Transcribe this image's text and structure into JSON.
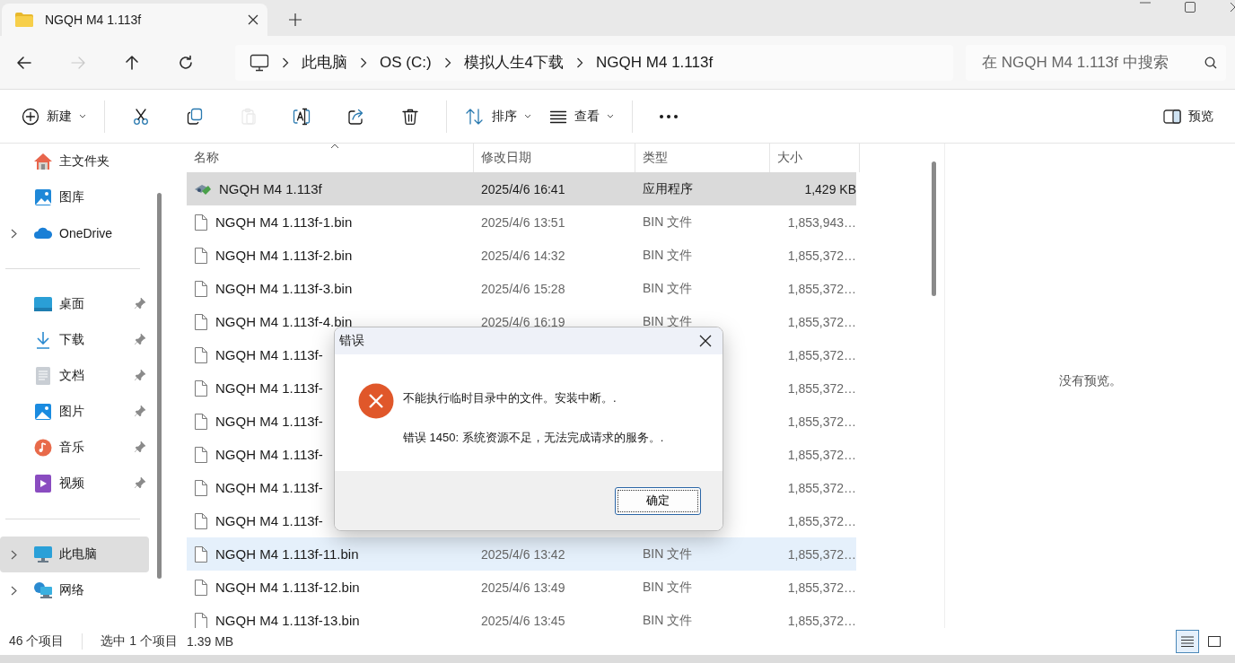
{
  "window": {
    "tab_title": "NGQH M4 1.113f"
  },
  "nav": [
    {
      "kind": "back",
      "disabled": false
    },
    {
      "kind": "forward",
      "disabled": true
    },
    {
      "kind": "up",
      "disabled": false
    },
    {
      "kind": "refresh",
      "disabled": false
    }
  ],
  "breadcrumb": [
    "此电脑",
    "OS (C:)",
    "模拟人生4下载",
    "NGQH M4 1.113f"
  ],
  "search": {
    "placeholder": "在 NGQH M4 1.113f 中搜索"
  },
  "toolbar": [
    {
      "kind": "new",
      "label": "新建",
      "disabled": false
    },
    {
      "kind": "cut",
      "disabled": false
    },
    {
      "kind": "copy",
      "disabled": false
    },
    {
      "kind": "paste",
      "disabled": true
    },
    {
      "kind": "rename",
      "disabled": false
    },
    {
      "kind": "share",
      "disabled": false
    },
    {
      "kind": "delete",
      "disabled": false
    },
    {
      "kind": "sort",
      "label": "排序",
      "disabled": false
    },
    {
      "kind": "view",
      "label": "查看",
      "disabled": false
    },
    {
      "kind": "more",
      "disabled": false
    }
  ],
  "preview_button": {
    "label": "预览"
  },
  "sidebar": {
    "groups": [
      [
        {
          "label": "主文件夹",
          "kind": "home",
          "expandable": false,
          "pinned": false,
          "selected": false
        },
        {
          "label": "图库",
          "kind": "gallery",
          "expandable": false,
          "pinned": false,
          "selected": false
        },
        {
          "label": "OneDrive",
          "kind": "cloud",
          "expandable": true,
          "pinned": false,
          "selected": false
        }
      ],
      [
        {
          "label": "桌面",
          "kind": "desktop",
          "expandable": false,
          "pinned": true,
          "selected": false
        },
        {
          "label": "下载",
          "kind": "download",
          "expandable": false,
          "pinned": true,
          "selected": false
        },
        {
          "label": "文档",
          "kind": "document",
          "expandable": false,
          "pinned": true,
          "selected": false
        },
        {
          "label": "图片",
          "kind": "pictures",
          "expandable": false,
          "pinned": true,
          "selected": false
        },
        {
          "label": "音乐",
          "kind": "music",
          "expandable": false,
          "pinned": true,
          "selected": false
        },
        {
          "label": "视频",
          "kind": "video",
          "expandable": false,
          "pinned": true,
          "selected": false
        }
      ],
      [
        {
          "label": "此电脑",
          "kind": "pc",
          "expandable": true,
          "pinned": false,
          "selected": true
        },
        {
          "label": "网络",
          "kind": "network",
          "expandable": true,
          "pinned": false,
          "selected": false
        }
      ]
    ]
  },
  "columns": [
    {
      "label": "名称",
      "sorted": true
    },
    {
      "label": "修改日期",
      "sorted": false
    },
    {
      "label": "类型",
      "sorted": false
    },
    {
      "label": "大小",
      "sorted": false
    }
  ],
  "rows": [
    {
      "kind": "app",
      "name": "NGQH M4 1.113f",
      "date": "2025/4/6 16:41",
      "type": "应用程序",
      "size": "1,429 KB",
      "selected": true,
      "hovered": false
    },
    {
      "kind": "file",
      "name": "NGQH M4 1.113f-1.bin",
      "date": "2025/4/6 13:51",
      "type": "BIN 文件",
      "size": "1,853,943…",
      "selected": false,
      "hovered": false
    },
    {
      "kind": "file",
      "name": "NGQH M4 1.113f-2.bin",
      "date": "2025/4/6 14:32",
      "type": "BIN 文件",
      "size": "1,855,372…",
      "selected": false,
      "hovered": false
    },
    {
      "kind": "file",
      "name": "NGQH M4 1.113f-3.bin",
      "date": "2025/4/6 15:28",
      "type": "BIN 文件",
      "size": "1,855,372…",
      "selected": false,
      "hovered": false
    },
    {
      "kind": "file",
      "name": "NGQH M4 1.113f-4.bin",
      "date": "2025/4/6 16:19",
      "type": "BIN 文件",
      "size": "1,855,372…",
      "selected": false,
      "hovered": false
    },
    {
      "kind": "file",
      "name": "NGQH M4 1.113f-",
      "size": "1,855,372…",
      "selected": false,
      "hovered": false
    },
    {
      "kind": "file",
      "name": "NGQH M4 1.113f-",
      "size": "1,855,372…",
      "selected": false,
      "hovered": false
    },
    {
      "kind": "file",
      "name": "NGQH M4 1.113f-",
      "size": "1,855,372…",
      "selected": false,
      "hovered": false
    },
    {
      "kind": "file",
      "name": "NGQH M4 1.113f-",
      "size": "1,855,372…",
      "selected": false,
      "hovered": false
    },
    {
      "kind": "file",
      "name": "NGQH M4 1.113f-",
      "size": "1,855,372…",
      "selected": false,
      "hovered": false
    },
    {
      "kind": "file",
      "name": "NGQH M4 1.113f-",
      "size": "1,855,372…",
      "selected": false,
      "hovered": false
    },
    {
      "kind": "file",
      "name": "NGQH M4 1.113f-11.bin",
      "date": "2025/4/6 13:42",
      "type": "BIN 文件",
      "size": "1,855,372…",
      "selected": false,
      "hovered": true
    },
    {
      "kind": "file",
      "name": "NGQH M4 1.113f-12.bin",
      "date": "2025/4/6 13:49",
      "type": "BIN 文件",
      "size": "1,855,372…",
      "selected": false,
      "hovered": false
    },
    {
      "kind": "file",
      "name": "NGQH M4 1.113f-13.bin",
      "date": "2025/4/6 13:45",
      "type": "BIN 文件",
      "size": "1,855,372…",
      "selected": false,
      "hovered": false
    }
  ],
  "preview": {
    "message": "没有预览。"
  },
  "status": {
    "item_count": "46 个项目",
    "selection": "选中 1 个项目",
    "selection_size": "1.39 MB"
  },
  "view_buttons": [
    {
      "kind": "details",
      "selected": true
    },
    {
      "kind": "tiles",
      "selected": false
    }
  ],
  "dialog": {
    "title": "错误",
    "kind": "error",
    "lines": [
      "不能执行临时目录中的文件。安装中断。.",
      "错误 1450: 系统资源不足，无法完成请求的服务。."
    ],
    "button": "确定"
  }
}
